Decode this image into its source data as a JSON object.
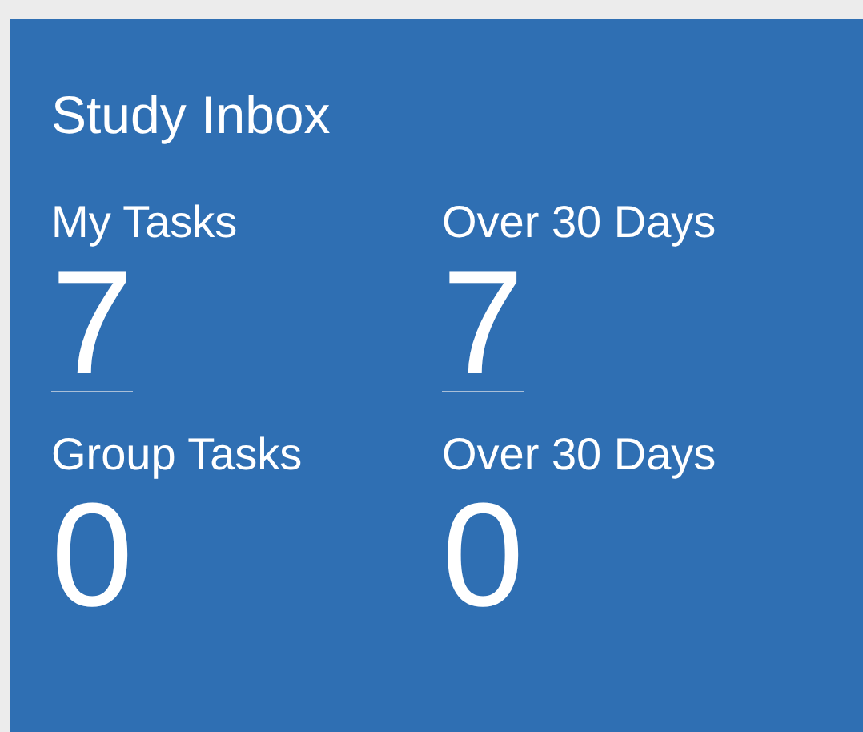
{
  "widget": {
    "title": "Study Inbox",
    "stats": [
      {
        "label": "My Tasks",
        "value": "7",
        "link": true
      },
      {
        "label": "Over 30 Days",
        "value": "7",
        "link": true
      },
      {
        "label": "Group Tasks",
        "value": "0",
        "link": false
      },
      {
        "label": "Over 30 Days",
        "value": "0",
        "link": false
      }
    ]
  }
}
